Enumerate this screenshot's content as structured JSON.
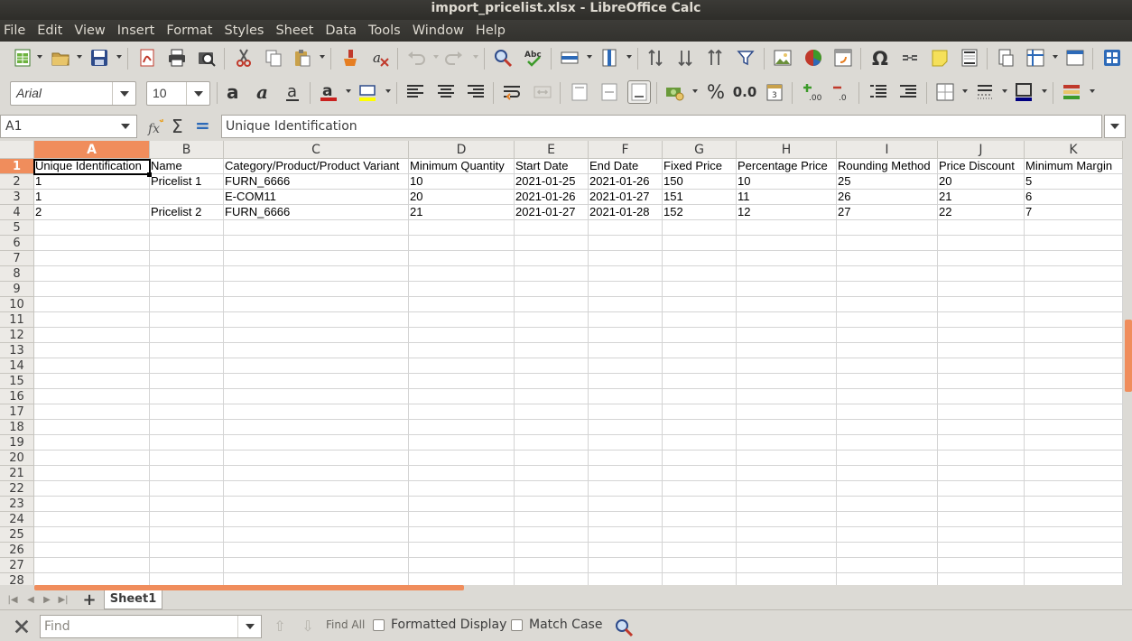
{
  "window": {
    "title": "import_pricelist.xlsx - LibreOffice Calc"
  },
  "menu": [
    "File",
    "Edit",
    "View",
    "Insert",
    "Format",
    "Styles",
    "Sheet",
    "Data",
    "Tools",
    "Window",
    "Help"
  ],
  "format_toolbar": {
    "font_name": "Arial",
    "font_size": "10",
    "number_percent": "%",
    "number_decimal": "0.0"
  },
  "formula_bar": {
    "cell_ref": "A1",
    "content": "Unique Identification",
    "sum_symbol": "Σ",
    "equals_symbol": "="
  },
  "columns": [
    "A",
    "B",
    "C",
    "D",
    "E",
    "F",
    "G",
    "H",
    "I",
    "J",
    "K"
  ],
  "selected_column": "A",
  "selected_row": 1,
  "row_numbers": [
    "1",
    "2",
    "3",
    "4",
    "5",
    "6",
    "7",
    "8",
    "9",
    "10",
    "11",
    "12",
    "13",
    "14",
    "15",
    "16",
    "17",
    "18",
    "19",
    "20",
    "21",
    "22",
    "23",
    "24",
    "25",
    "26",
    "27",
    "28"
  ],
  "rows": [
    [
      "Unique Identification",
      "Name",
      "Category/Product/Product Variant",
      "Minimum Quantity",
      "Start Date",
      "End Date",
      "Fixed Price",
      "Percentage Price",
      "Rounding Method",
      "Price Discount",
      "Minimum Margin"
    ],
    [
      "1",
      "Pricelist 1",
      "FURN_6666",
      "10",
      "2021-01-25",
      "2021-01-26",
      "150",
      "10",
      "25",
      "20",
      "5"
    ],
    [
      "1",
      "",
      "E-COM11",
      "20",
      "2021-01-26",
      "2021-01-27",
      "151",
      "11",
      "26",
      "21",
      "6"
    ],
    [
      "2",
      "Pricelist 2",
      "FURN_6666",
      "21",
      "2021-01-27",
      "2021-01-28",
      "152",
      "12",
      "27",
      "22",
      "7"
    ]
  ],
  "sheet_tabs": {
    "add_label": "+",
    "tabs": [
      "Sheet1"
    ]
  },
  "find_bar": {
    "placeholder": "Find",
    "find_all_label": "Find All",
    "formatted_display_label": "Formatted Display",
    "match_case_label": "Match Case"
  },
  "colors": {
    "accent": "#f08d5c",
    "titlebar": "#3b3a36",
    "chrome": "#dcdad5"
  }
}
